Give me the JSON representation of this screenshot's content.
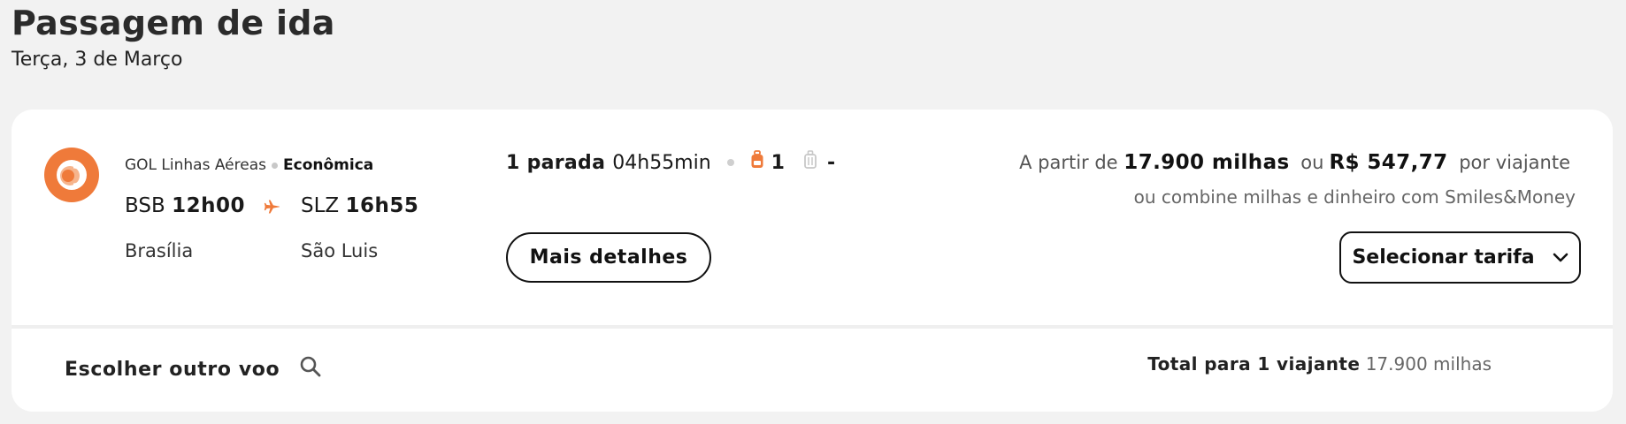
{
  "page": {
    "title": "Passagem de ida",
    "date": "Terça, 3 de Março"
  },
  "flight": {
    "airline": "GOL Linhas Aéreas",
    "cabin": "Econômica",
    "departure": {
      "code": "BSB",
      "time": "12h00",
      "city": "Brasília"
    },
    "arrival": {
      "code": "SLZ",
      "time": "16h55",
      "city": "São Luis"
    },
    "stops": "1 parada",
    "duration": "04h55min",
    "carry_on_count": "1",
    "checked_bag": "-",
    "details_button": "Mais detalhes"
  },
  "price": {
    "from_label": "A partir de",
    "miles": "17.900 milhas",
    "or_label": "ou",
    "money": "R$ 547,77",
    "per_traveler": "por viajante",
    "combine_text": "ou combine milhas e dinheiro com Smiles&Money",
    "select_button": "Selecionar tarifa"
  },
  "footer": {
    "choose_other": "Escolher outro voo",
    "total_label": "Total para 1 viajante",
    "total_value": "17.900 milhas"
  },
  "colors": {
    "accent": "#ef7a3a",
    "background": "#f2f2f2",
    "card": "#ffffff"
  },
  "icons": {
    "logo": "gol-logo-icon",
    "plane": "airplane-icon",
    "carry_on": "backpack-icon",
    "checked": "suitcase-icon",
    "dropdown": "chevron-down-icon",
    "search": "search-icon"
  }
}
